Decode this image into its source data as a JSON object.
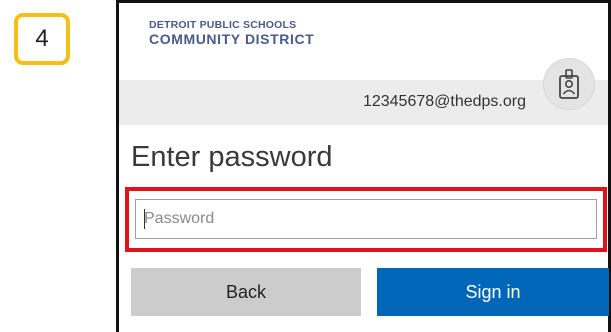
{
  "step": {
    "number": "4"
  },
  "logo": {
    "line1": "DETROIT PUBLIC SCHOOLS",
    "line2": "COMMUNITY DISTRICT"
  },
  "account": {
    "email": "12345678@thedps.org",
    "icon": "id-badge-icon"
  },
  "heading": "Enter password",
  "password": {
    "placeholder": "Password",
    "value": ""
  },
  "buttons": {
    "back": "Back",
    "sign_in": "Sign in"
  },
  "colors": {
    "step_badge_border": "#f5bf16",
    "highlight": "#e2121a",
    "sign_in_bg": "#0067b8",
    "back_bg": "#cccccc",
    "logo_text": "#4a5a8c"
  }
}
